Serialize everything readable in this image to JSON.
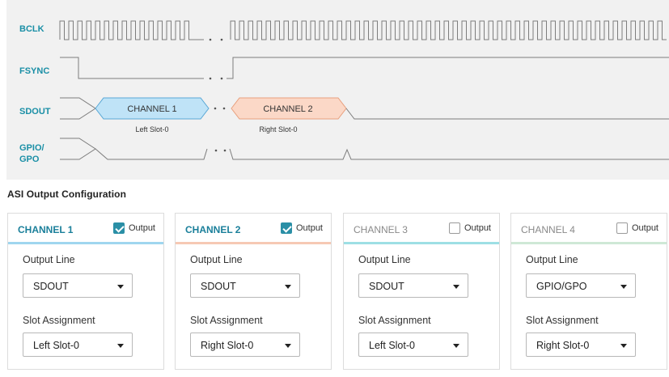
{
  "timing": {
    "signals": [
      "BCLK",
      "FSYNC",
      "SDOUT",
      "GPIO/",
      "GPO"
    ],
    "channel_labels": [
      "CHANNEL 1",
      "CHANNEL 2"
    ],
    "slot_labels": [
      "Left Slot-0",
      "Right Slot-0"
    ],
    "colors": {
      "channel1_fill": "#bfe3f7",
      "channel1_stroke": "#5aa8d6",
      "channel2_fill": "#fbd8c7",
      "channel2_stroke": "#e8a07e"
    }
  },
  "section_title": "ASI Output Configuration",
  "cards": [
    {
      "title": "CHANNEL 1",
      "checkbox_label": "Output",
      "checked": true,
      "accent": "#9fd6ef",
      "output_line_label": "Output Line",
      "output_line_value": "SDOUT",
      "slot_label": "Slot Assignment",
      "slot_value": "Left Slot-0"
    },
    {
      "title": "CHANNEL 2",
      "checkbox_label": "Output",
      "checked": true,
      "accent": "#f6c9b4",
      "output_line_label": "Output Line",
      "output_line_value": "SDOUT",
      "slot_label": "Slot Assignment",
      "slot_value": "Right Slot-0"
    },
    {
      "title": "CHANNEL 3",
      "checkbox_label": "Output",
      "checked": false,
      "accent": "#9ddfe4",
      "output_line_label": "Output Line",
      "output_line_value": "SDOUT",
      "slot_label": "Slot Assignment",
      "slot_value": "Left Slot-0"
    },
    {
      "title": "CHANNEL 4",
      "checkbox_label": "Output",
      "checked": false,
      "accent": "#cfe8d6",
      "output_line_label": "Output Line",
      "output_line_value": "GPIO/GPO",
      "slot_label": "Slot Assignment",
      "slot_value": "Right Slot-0"
    }
  ]
}
